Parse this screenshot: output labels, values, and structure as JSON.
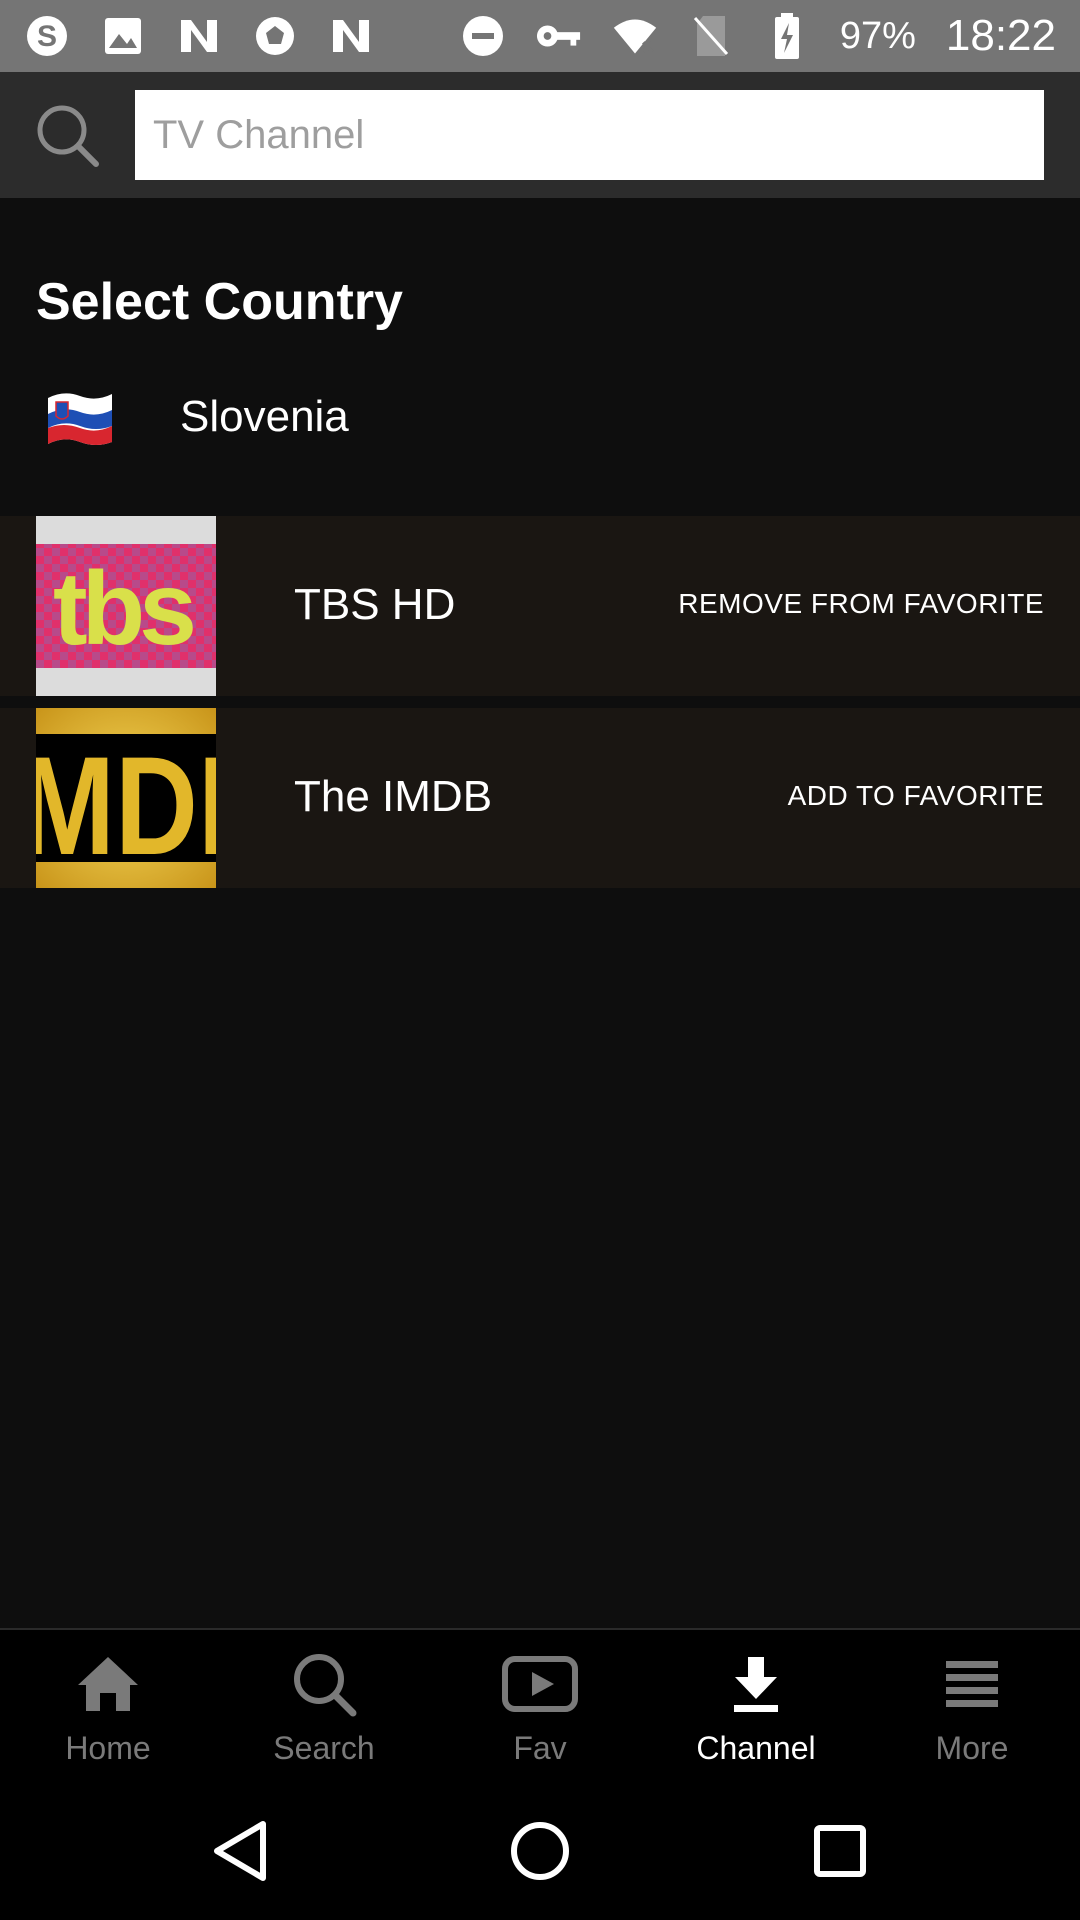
{
  "status_bar": {
    "left_icons": [
      "skype-icon",
      "image-icon",
      "n-app-icon",
      "soccer-ball-icon",
      "n-app-icon"
    ],
    "right_icons": [
      "do-not-disturb-icon",
      "vpn-key-icon",
      "wifi-icon",
      "no-sim-icon",
      "battery-charging-icon"
    ],
    "battery": "97%",
    "time": "18:22"
  },
  "search": {
    "placeholder": "TV Channel"
  },
  "country_section": {
    "title": "Select Country",
    "selected_country": "Slovenia"
  },
  "channels": [
    {
      "name": "TBS HD",
      "logo": "tbs-logo",
      "action": "REMOVE FROM FAVORITE"
    },
    {
      "name": "The IMDB",
      "logo": "imdb-logo",
      "logo_text": "MDI",
      "action": "ADD TO FAVORITE"
    }
  ],
  "bottom_nav": {
    "active": "Channel",
    "items": [
      {
        "label": "Home",
        "icon": "home-icon"
      },
      {
        "label": "Search",
        "icon": "search-icon"
      },
      {
        "label": "Fav",
        "icon": "play-icon"
      },
      {
        "label": "Channel",
        "icon": "download-icon"
      },
      {
        "label": "More",
        "icon": "menu-icon"
      }
    ]
  },
  "colors": {
    "status_bar": "#757575",
    "search_bar": "#2c2c2c",
    "background": "#0e0e0e",
    "channel_row": "#1a1612",
    "nav_inactive": "#7a7a7a",
    "nav_active": "#ffffff",
    "tbs_pink": "#e0306b",
    "tbs_yellow": "#d9e04a",
    "imdb_gold": "#e2b72a"
  }
}
